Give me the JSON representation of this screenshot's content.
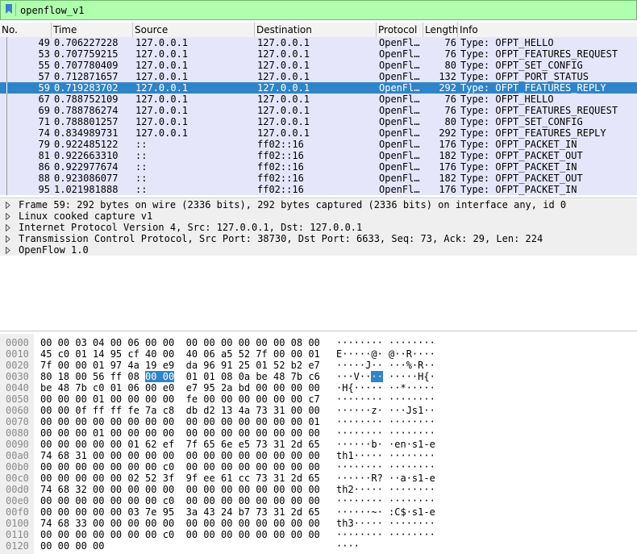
{
  "filter": {
    "value": "openflow_v1"
  },
  "packet_list": {
    "columns": [
      "No.",
      "Time",
      "Source",
      "Destination",
      "Protocol",
      "Length",
      "Info"
    ],
    "selected_index": 4,
    "rows": [
      {
        "no": "49",
        "time": "0.706227228",
        "src": "127.0.0.1",
        "dst": "127.0.0.1",
        "proto": "OpenFl…",
        "len": "76",
        "info": "Type: OFPT_HELLO"
      },
      {
        "no": "53",
        "time": "0.707759215",
        "src": "127.0.0.1",
        "dst": "127.0.0.1",
        "proto": "OpenFl…",
        "len": "76",
        "info": "Type: OFPT_FEATURES_REQUEST"
      },
      {
        "no": "55",
        "time": "0.707780409",
        "src": "127.0.0.1",
        "dst": "127.0.0.1",
        "proto": "OpenFl…",
        "len": "80",
        "info": "Type: OFPT_SET_CONFIG"
      },
      {
        "no": "57",
        "time": "0.712871657",
        "src": "127.0.0.1",
        "dst": "127.0.0.1",
        "proto": "OpenFl…",
        "len": "132",
        "info": "Type: OFPT_PORT_STATUS"
      },
      {
        "no": "59",
        "time": "0.719283702",
        "src": "127.0.0.1",
        "dst": "127.0.0.1",
        "proto": "OpenFl…",
        "len": "292",
        "info": "Type: OFPT_FEATURES_REPLY"
      },
      {
        "no": "67",
        "time": "0.788752109",
        "src": "127.0.0.1",
        "dst": "127.0.0.1",
        "proto": "OpenFl…",
        "len": "76",
        "info": "Type: OFPT_HELLO"
      },
      {
        "no": "69",
        "time": "0.788786274",
        "src": "127.0.0.1",
        "dst": "127.0.0.1",
        "proto": "OpenFl…",
        "len": "76",
        "info": "Type: OFPT_FEATURES_REQUEST"
      },
      {
        "no": "71",
        "time": "0.788801257",
        "src": "127.0.0.1",
        "dst": "127.0.0.1",
        "proto": "OpenFl…",
        "len": "80",
        "info": "Type: OFPT_SET_CONFIG"
      },
      {
        "no": "74",
        "time": "0.834989731",
        "src": "127.0.0.1",
        "dst": "127.0.0.1",
        "proto": "OpenFl…",
        "len": "292",
        "info": "Type: OFPT_FEATURES_REPLY"
      },
      {
        "no": "79",
        "time": "0.922485122",
        "src": "::",
        "dst": "ff02::16",
        "proto": "OpenFl…",
        "len": "176",
        "info": "Type: OFPT_PACKET_IN"
      },
      {
        "no": "81",
        "time": "0.922663310",
        "src": "::",
        "dst": "ff02::16",
        "proto": "OpenFl…",
        "len": "182",
        "info": "Type: OFPT_PACKET_OUT"
      },
      {
        "no": "86",
        "time": "0.922977674",
        "src": "::",
        "dst": "ff02::16",
        "proto": "OpenFl…",
        "len": "176",
        "info": "Type: OFPT_PACKET_IN"
      },
      {
        "no": "88",
        "time": "0.923086077",
        "src": "::",
        "dst": "ff02::16",
        "proto": "OpenFl…",
        "len": "182",
        "info": "Type: OFPT_PACKET_OUT"
      },
      {
        "no": "95",
        "time": "1.021981888",
        "src": "::",
        "dst": "ff02::16",
        "proto": "OpenFl…",
        "len": "176",
        "info": "Type: OFPT_PACKET_IN"
      }
    ]
  },
  "details": [
    "Frame 59: 292 bytes on wire (2336 bits), 292 bytes captured (2336 bits) on interface any, id 0",
    "Linux cooked capture v1",
    "Internet Protocol Version 4, Src: 127.0.0.1, Dst: 127.0.0.1",
    "Transmission Control Protocol, Src Port: 38730, Dst Port: 6633, Seq: 73, Ack: 29, Len: 224",
    "OpenFlow 1.0"
  ],
  "bytes": [
    {
      "off": "0000",
      "hex": "00 00 03 04 00 06 00 00  00 00 00 00 00 00 08 00",
      "asc": "········ ········"
    },
    {
      "off": "0010",
      "hex": "45 c0 01 14 95 cf 40 00  40 06 a5 52 7f 00 00 01",
      "asc": "E·····@· @··R····"
    },
    {
      "off": "0020",
      "hex": "7f 00 00 01 97 4a 19 e9  da 96 91 25 01 52 b2 e7",
      "asc": "·····J·· ···%·R··"
    },
    {
      "off": "0030",
      "hex_pre": "80 18 00 56 ff 08 ",
      "hex_hl": "00 00",
      "hex_post": "  01 01 08 0a be 48 7b c6",
      "asc_pre": "···V··",
      "asc_hl": "··",
      "asc_post": " ·····H{·"
    },
    {
      "off": "0040",
      "hex": "be 48 7b c0 01 06 00 e0  e7 95 2a bd 00 00 00 00",
      "asc": "·H{····· ··*·····"
    },
    {
      "off": "0050",
      "hex": "00 00 00 01 00 00 00 00  fe 00 00 00 00 00 00 c7",
      "asc": "········ ········"
    },
    {
      "off": "0060",
      "hex": "00 00 0f ff ff fe 7a c8  db d2 13 4a 73 31 00 00",
      "asc": "······z· ···Js1··"
    },
    {
      "off": "0070",
      "hex": "00 00 00 00 00 00 00 00  00 00 00 00 00 00 00 01",
      "asc": "········ ········"
    },
    {
      "off": "0080",
      "hex": "00 00 00 01 00 00 00 00  00 00 00 00 00 00 00 00",
      "asc": "········ ········"
    },
    {
      "off": "0090",
      "hex": "00 00 00 00 00 01 62 ef  7f 65 6e e5 73 31 2d 65",
      "asc": "······b· ·en·s1-e"
    },
    {
      "off": "00a0",
      "hex": "74 68 31 00 00 00 00 00  00 00 00 00 00 00 00 00",
      "asc": "th1····· ········"
    },
    {
      "off": "00b0",
      "hex": "00 00 00 00 00 00 00 c0  00 00 00 00 00 00 00 00",
      "asc": "········ ········"
    },
    {
      "off": "00c0",
      "hex": "00 00 00 00 00 02 52 3f  9f ee 61 cc 73 31 2d 65",
      "asc": "······R? ··a·s1-e"
    },
    {
      "off": "00d0",
      "hex": "74 68 32 00 00 00 00 00  00 00 00 00 00 00 00 00",
      "asc": "th2····· ········"
    },
    {
      "off": "00e0",
      "hex": "00 00 00 00 00 00 00 c0  00 00 00 00 00 00 00 00",
      "asc": "········ ········"
    },
    {
      "off": "00f0",
      "hex": "00 00 00 00 00 03 7e 95  3a 43 24 b7 73 31 2d 65",
      "asc": "······~· :C$·s1-e"
    },
    {
      "off": "0100",
      "hex": "74 68 33 00 00 00 00 00  00 00 00 00 00 00 00 00",
      "asc": "th3····· ········"
    },
    {
      "off": "0110",
      "hex": "00 00 00 00 00 00 00 c0  00 00 00 00 00 00 00 00",
      "asc": "········ ········"
    },
    {
      "off": "0120",
      "hex": "00 00 00 00",
      "asc": "····"
    }
  ],
  "colors": {
    "filter_valid": "#afffaf",
    "row_bg": "#e6e6fa",
    "selection": "#2f84c8"
  }
}
